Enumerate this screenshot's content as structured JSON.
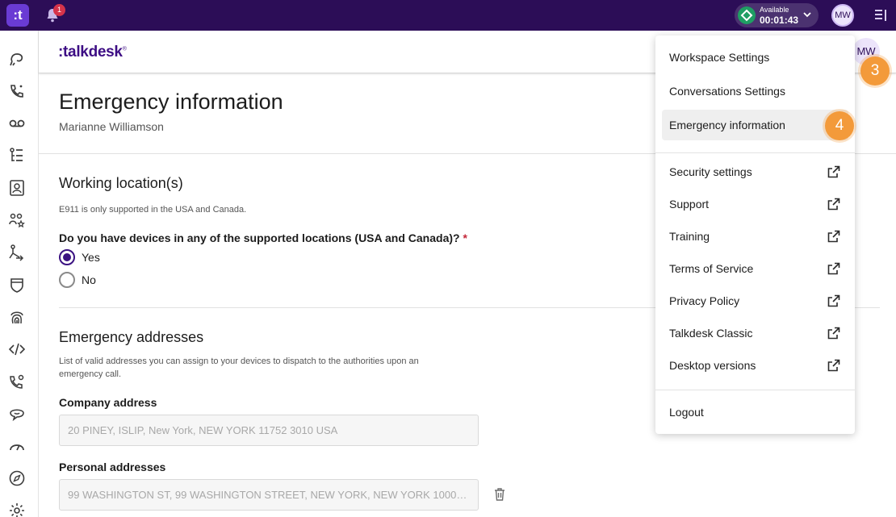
{
  "topbar": {
    "app_logo": ":t",
    "notification_count": "1",
    "status_label": "Available",
    "status_time": "00:01:43",
    "avatar_initials": "MW"
  },
  "rail_icons": [
    "conversations-icon",
    "calls-icon",
    "voicemail-icon",
    "tasks-icon",
    "contacts-icon",
    "team-icon",
    "workflow-icon",
    "shield-icon",
    "fingerprint-icon",
    "code-icon",
    "phone-settings-icon",
    "chat-icon",
    "dashboard-icon",
    "compass-icon",
    "settings-icon"
  ],
  "header": {
    "brand": ":talkdesk",
    "brand_tm": "®",
    "avatar_initials": "MW"
  },
  "steps": {
    "avatar_step": "3",
    "menu_step": "4"
  },
  "page": {
    "title": "Emergency information",
    "subtitle": "Marianne Williamson"
  },
  "working": {
    "title": "Working location(s)",
    "hint": "E911 is only supported in the USA and Canada.",
    "question": "Do you have devices in any of the supported locations (USA and Canada)?",
    "required_mark": "*",
    "option_yes": "Yes",
    "option_no": "No",
    "selected": "Yes"
  },
  "addresses": {
    "title": "Emergency addresses",
    "hint": "List of valid addresses you can assign to your devices to dispatch to the authorities upon an emergency call.",
    "company_label": "Company address",
    "company_value": "20 PINEY, ISLIP, New York, NEW YORK 11752 3010 USA",
    "personal_label": "Personal addresses",
    "personal_value": "99 WASHINGTON ST, 99 WASHINGTON STREET, NEW YORK, NEW YORK 10006…"
  },
  "menu": {
    "workspace": "Workspace Settings",
    "conversations": "Conversations Settings",
    "emergency": "Emergency information",
    "security": "Security settings",
    "support": "Support",
    "training": "Training",
    "terms": "Terms of Service",
    "privacy": "Privacy Policy",
    "classic": "Talkdesk Classic",
    "desktop": "Desktop versions",
    "logout": "Logout"
  },
  "colors": {
    "topbar": "#2c0d57",
    "accent": "#3b1282",
    "step_badge": "#f39a3a",
    "available": "#1f9e63"
  }
}
